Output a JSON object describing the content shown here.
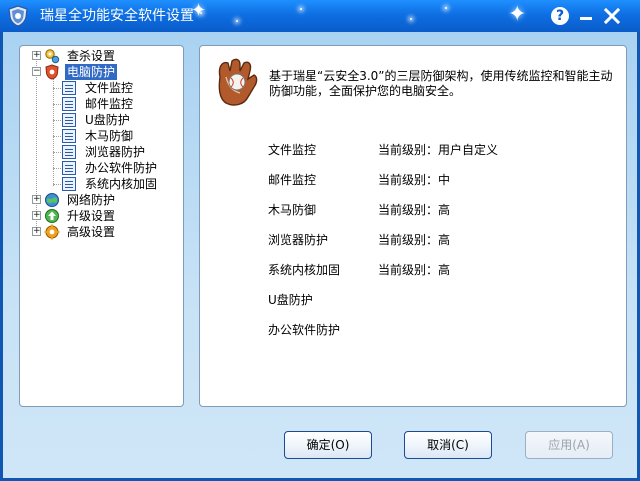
{
  "window": {
    "title": "瑞星全功能安全软件设置",
    "help_glyph": "?",
    "minimize_glyph": "−",
    "close_glyph": "✕"
  },
  "tree": {
    "items": [
      {
        "label": "查杀设置",
        "icon": "scan-settings-icon",
        "expander": "+"
      },
      {
        "label": "电脑防护",
        "icon": "computer-protection-icon",
        "expander": "−",
        "selected": true,
        "children": [
          {
            "label": "文件监控"
          },
          {
            "label": "邮件监控"
          },
          {
            "label": "U盘防护"
          },
          {
            "label": "木马防御"
          },
          {
            "label": "浏览器防护"
          },
          {
            "label": "办公软件防护"
          },
          {
            "label": "系统内核加固"
          }
        ]
      },
      {
        "label": "网络防护",
        "icon": "network-protection-icon",
        "expander": "+"
      },
      {
        "label": "升级设置",
        "icon": "update-settings-icon",
        "expander": "+"
      },
      {
        "label": "高级设置",
        "icon": "advanced-settings-icon",
        "expander": "+"
      }
    ]
  },
  "content": {
    "intro": "基于瑞星“云安全3.0”的三层防御架构，使用传统监控和智能主动防御功能，全面保护您的电脑安全。",
    "features": [
      {
        "name": "文件监控",
        "level": "当前级别：用户自定义"
      },
      {
        "name": "邮件监控",
        "level": "当前级别：中"
      },
      {
        "name": "木马防御",
        "level": "当前级别：高"
      },
      {
        "name": "浏览器防护",
        "level": "当前级别：高"
      },
      {
        "name": "系统内核加固",
        "level": "当前级别：高"
      },
      {
        "name": "U盘防护",
        "level": ""
      },
      {
        "name": "办公软件防护",
        "level": ""
      }
    ]
  },
  "buttons": {
    "ok": "确定(O)",
    "cancel": "取消(C)",
    "apply": "应用(A)"
  },
  "colors": {
    "titlebar": "#0e6fe3",
    "client_bg": "#c7e2f6",
    "selection": "#316ac5",
    "close_x": "#ffffff"
  }
}
